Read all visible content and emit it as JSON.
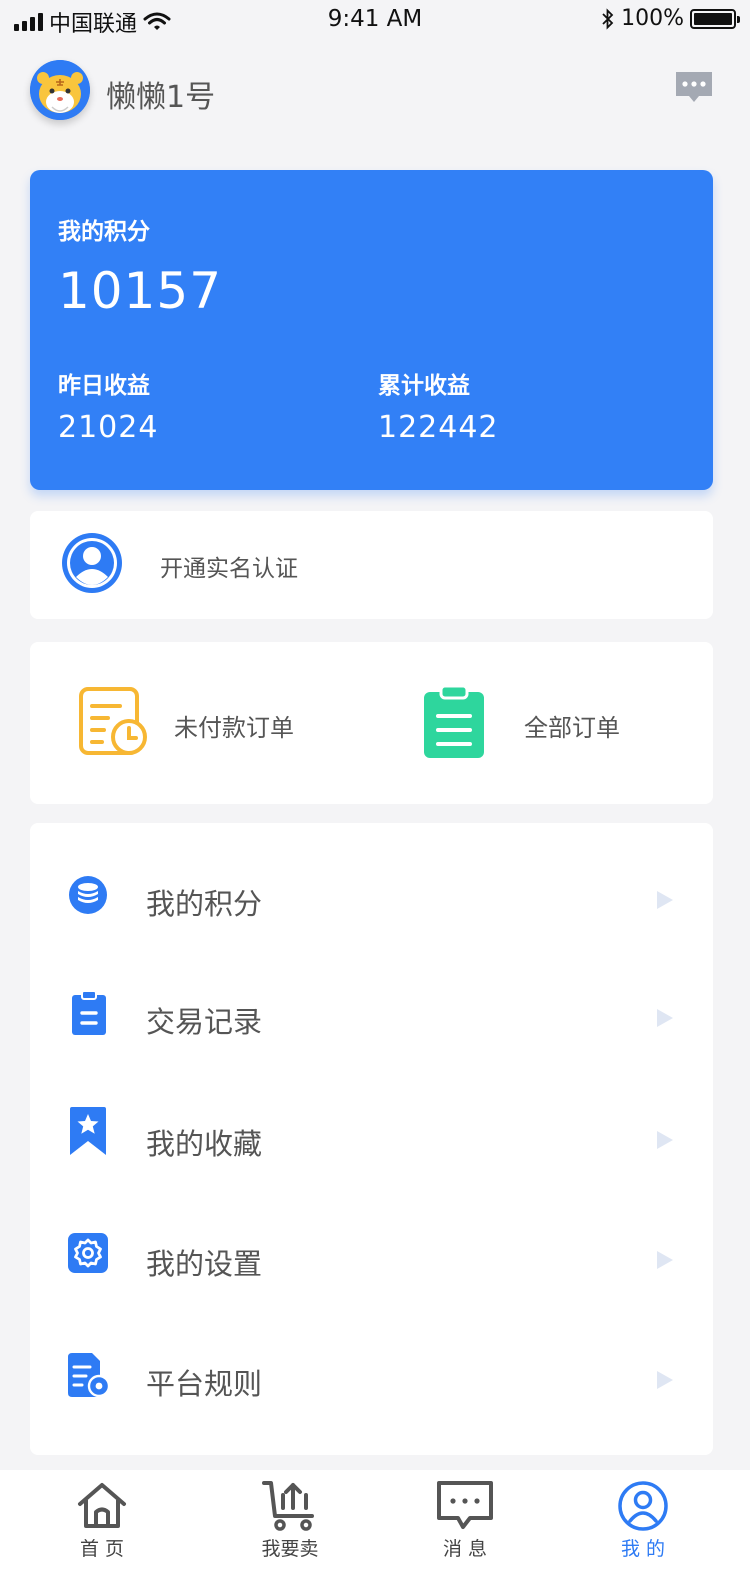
{
  "status_bar": {
    "carrier": "中国联通",
    "time": "9:41 AM",
    "battery": "100%"
  },
  "header": {
    "username": "懒懒1号"
  },
  "points_card": {
    "label": "我的积分",
    "value": "10157",
    "yesterday_label": "昨日收益",
    "yesterday_value": "21024",
    "total_label": "累计收益",
    "total_value": "122442"
  },
  "verify": {
    "label": "开通实名认证"
  },
  "orders": {
    "unpaid_label": "未付款订单",
    "all_label": "全部订单"
  },
  "menu": {
    "items": [
      {
        "label": "我的积分",
        "icon": "coins-icon"
      },
      {
        "label": "交易记录",
        "icon": "clipboard-icon"
      },
      {
        "label": "我的收藏",
        "icon": "bookmark-star-icon"
      },
      {
        "label": "我的设置",
        "icon": "gear-icon"
      },
      {
        "label": "平台规则",
        "icon": "rules-document-icon"
      }
    ]
  },
  "tabbar": {
    "items": [
      {
        "label": "首 页",
        "icon": "home-icon"
      },
      {
        "label": "我要卖",
        "icon": "sell-cart-icon"
      },
      {
        "label": "消 息",
        "icon": "message-icon"
      },
      {
        "label": "我 的",
        "icon": "profile-icon"
      }
    ],
    "active_index": 3
  },
  "colors": {
    "accent": "#3280f6",
    "unpaid_icon": "#f7b733",
    "all_orders_icon": "#2ed69d",
    "background": "#f4f4f6"
  }
}
